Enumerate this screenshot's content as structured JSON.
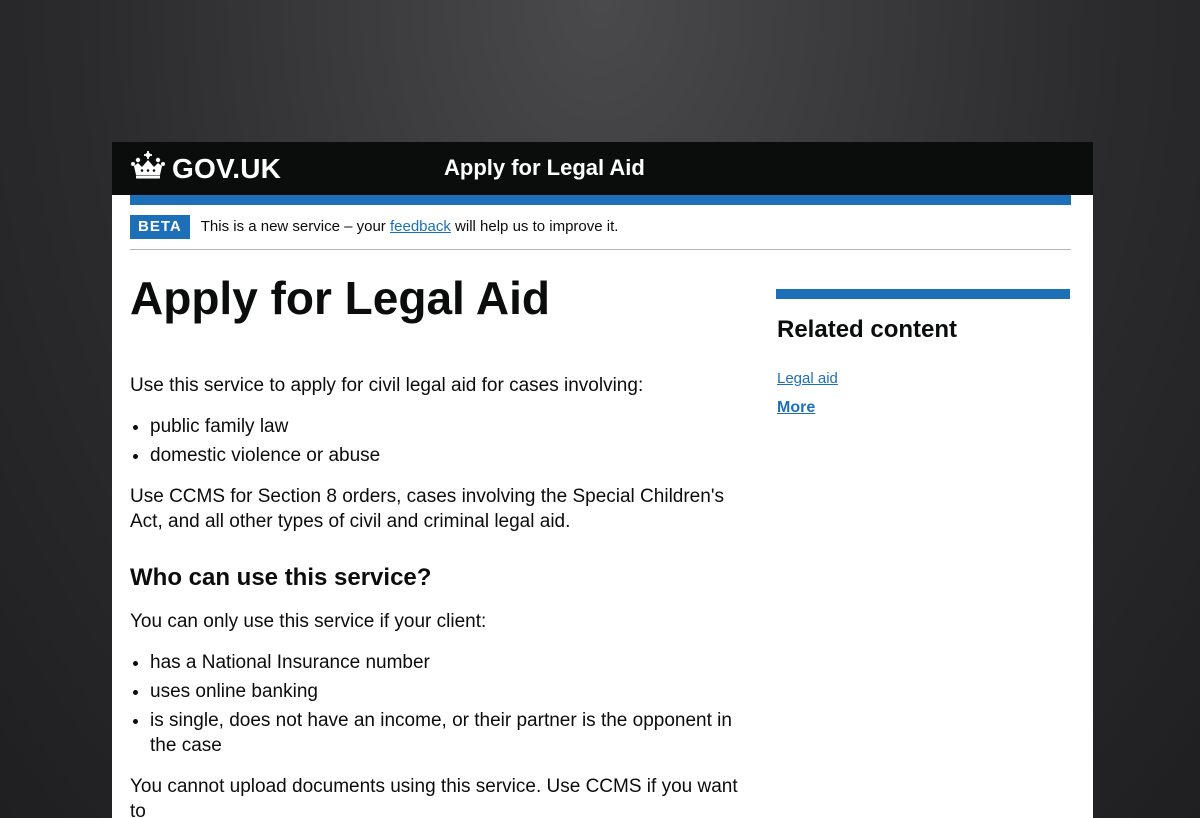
{
  "header": {
    "logo_text": "GOV.UK",
    "service_name": "Apply for Legal Aid"
  },
  "phase_banner": {
    "tag": "BETA",
    "text_before": "This is a new service – your ",
    "link_text": "feedback",
    "text_after": " will help us to improve it."
  },
  "main": {
    "title": "Apply for Legal Aid",
    "intro": "Use this service to apply for civil legal aid for cases involving:",
    "case_types": [
      "public family law",
      "domestic violence or abuse"
    ],
    "ccms_note": "Use CCMS for Section 8 orders, cases involving the Special Children's Act, and all other types of civil and criminal legal aid.",
    "who_heading": "Who can use this service?",
    "who_intro": "You can only use this service if your client:",
    "criteria": [
      "has a National Insurance number",
      "uses online banking",
      "is single, does not have an income, or their partner is the opponent in the case"
    ],
    "upload_note": "You cannot upload documents using this service. Use CCMS if you want to"
  },
  "related": {
    "heading": "Related content",
    "links": [
      "Legal aid"
    ],
    "more": "More"
  },
  "colors": {
    "header_bg": "#0b0c0c",
    "brand_blue": "#1d70b8",
    "text": "#0b0c0c",
    "page_bg": "#ffffff"
  },
  "icons": {
    "logo": "crown-icon"
  }
}
